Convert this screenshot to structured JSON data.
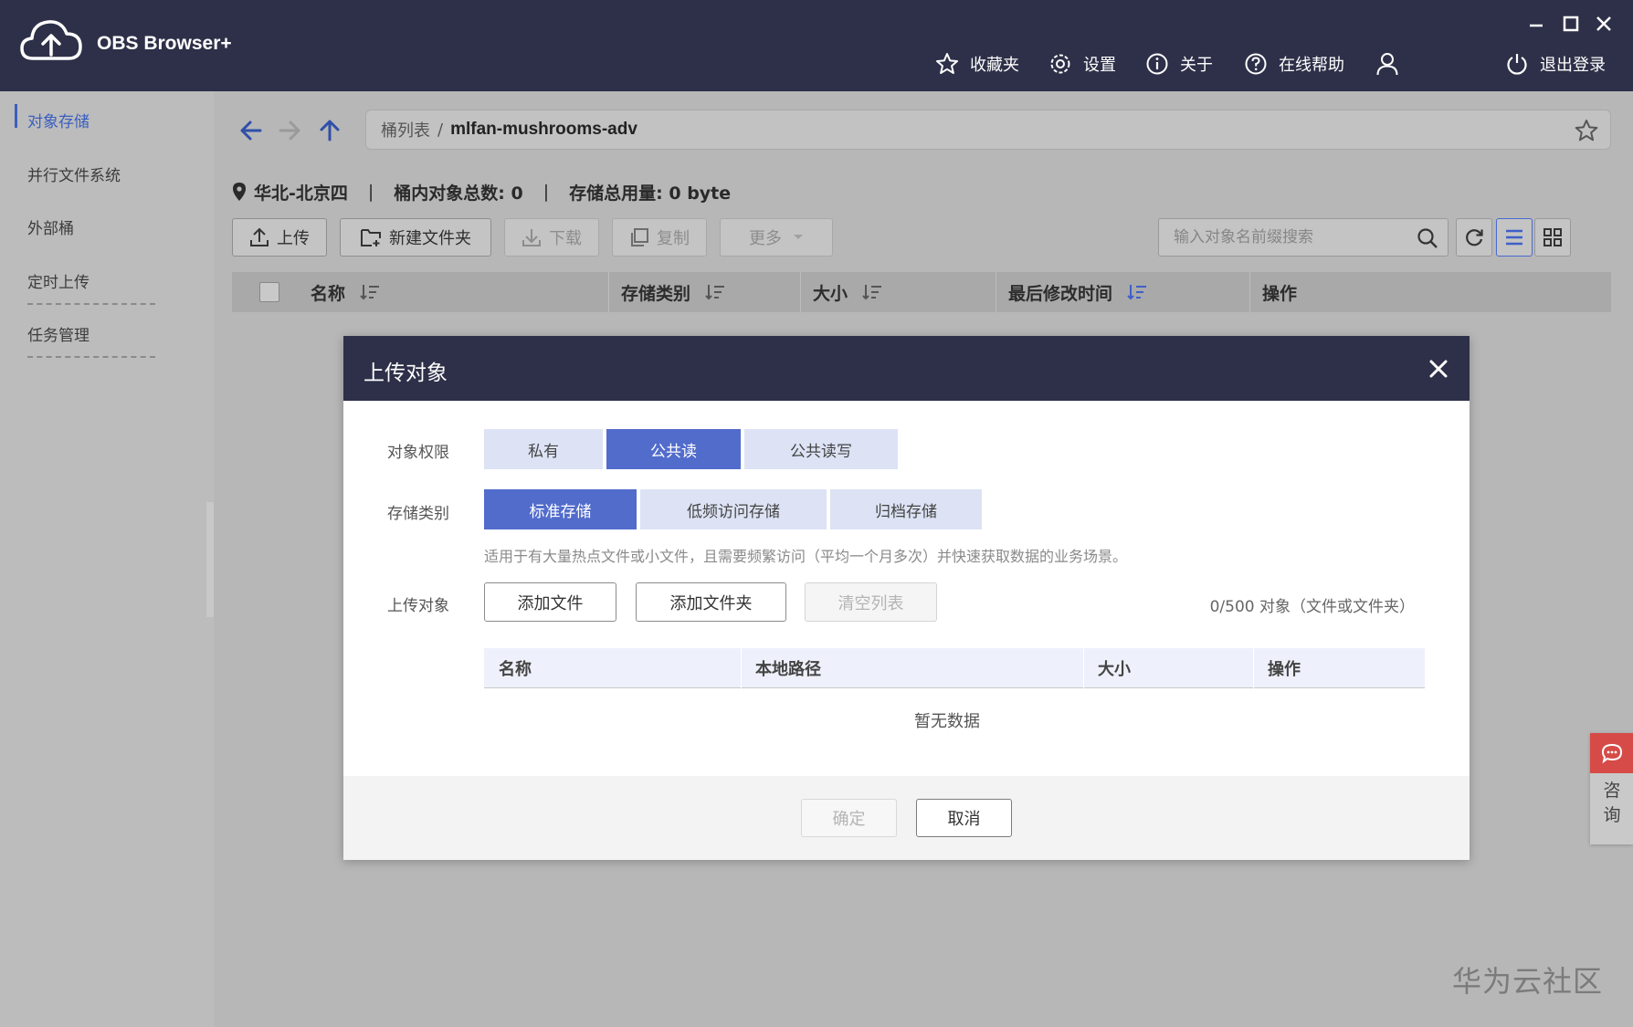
{
  "app": {
    "title": "OBS Browser+",
    "nav": {
      "favorites": "收藏夹",
      "settings": "设置",
      "about": "关于",
      "help": "在线帮助",
      "logout": "退出登录"
    }
  },
  "sidebar": {
    "items": [
      {
        "label": "对象存储",
        "active": true
      },
      {
        "label": "并行文件系统",
        "active": false
      },
      {
        "label": "外部桶",
        "active": false
      },
      {
        "label": "定时上传",
        "active": false
      },
      {
        "label": "任务管理",
        "active": false
      }
    ]
  },
  "path": {
    "root": "桶列表",
    "separator": "/",
    "current": "mlfan-mushrooms-adv"
  },
  "info": {
    "region": "华北-北京四",
    "divider": "|",
    "object_count": "桶内对象总数: 0",
    "storage_used": "存储总用量: 0 byte"
  },
  "toolbar": {
    "upload": "上传",
    "new_folder": "新建文件夹",
    "download": "下载",
    "copy": "复制",
    "more": "更多",
    "search_placeholder": "输入对象名前缀搜索"
  },
  "table": {
    "columns": [
      "名称",
      "存储类别",
      "大小",
      "最后修改时间",
      "操作"
    ]
  },
  "modal": {
    "title": "上传对象",
    "permission_label": "对象权限",
    "permission_options": [
      "私有",
      "公共读",
      "公共读写"
    ],
    "permission_selected": "公共读",
    "storage_label": "存储类别",
    "storage_options": [
      "标准存储",
      "低频访问存储",
      "归档存储"
    ],
    "storage_selected": "标准存储",
    "storage_description": "适用于有大量热点文件或小文件，且需要频繁访问（平均一个月多次）并快速获取数据的业务场景。",
    "upload_label": "上传对象",
    "add_file": "添加文件",
    "add_folder": "添加文件夹",
    "clear_list": "清空列表",
    "object_count": "0/500 对象（文件或文件夹）",
    "table_columns": [
      "名称",
      "本地路径",
      "大小",
      "操作"
    ],
    "empty_text": "暂无数据",
    "confirm": "确定",
    "cancel": "取消"
  },
  "consult": {
    "label": "咨询"
  },
  "watermark": "华为云社区",
  "colors": {
    "header_bg": "#2d3048",
    "accent": "#526ccc",
    "segment_bg": "#dde3f5",
    "consult_red": "#d64b47"
  }
}
